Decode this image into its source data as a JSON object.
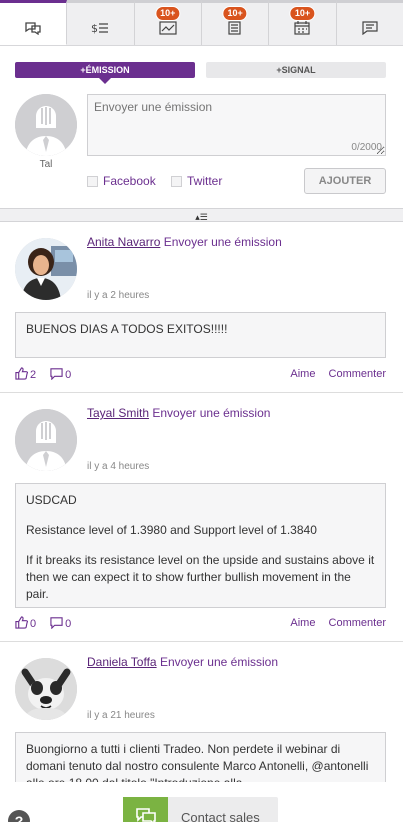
{
  "tabs": [
    {
      "icon": "messages-icon",
      "active": true,
      "badge": ""
    },
    {
      "icon": "price-list-icon",
      "active": false,
      "badge": ""
    },
    {
      "icon": "chart-icon",
      "active": false,
      "badge": "10+"
    },
    {
      "icon": "news-icon",
      "active": false,
      "badge": "10+"
    },
    {
      "icon": "calendar-icon",
      "active": false,
      "badge": "10+"
    },
    {
      "icon": "chat-icon",
      "active": false,
      "badge": ""
    }
  ],
  "compose": {
    "emission_tab": "+ÉMISSION",
    "signal_tab": "+SIGNAL",
    "user_name": "Tal",
    "placeholder": "Envoyer une émission",
    "counter": "0/2000",
    "facebook": "Facebook",
    "twitter": "Twitter",
    "add_button": "AJOUTER"
  },
  "collapse_icon": "collapse-icon",
  "feed": [
    {
      "author": "Anita Navarro",
      "action": "Envoyer une émission",
      "time": "il y a 2 heures",
      "text": [
        "BUENOS DIAS A TODOS EXITOS!!!!!"
      ],
      "likes": "2",
      "comments": "0",
      "like_label": "Aime",
      "comment_label": "Commenter"
    },
    {
      "author": "Tayal Smith",
      "action": "Envoyer une émission",
      "time": "il y a 4 heures",
      "text": [
        "USDCAD",
        "Resistance level of 1.3980 and Support level of 1.3840",
        "If it breaks its resistance level on the upside and sustains above it then we can expect it to show further bullish movement in the pair."
      ],
      "likes": "0",
      "comments": "0",
      "like_label": "Aime",
      "comment_label": "Commenter"
    },
    {
      "author": "Daniela Toffa",
      "action": "Envoyer une émission",
      "time": "il y a 21 heures",
      "text": [
        "Buongiorno a tutti i clienti Tradeo. Non perdete il webinar di domani tenuto dal nostro consulente Marco Antonelli, @antonelli alle ore 18.00 dal titolo \"Introduzione alla"
      ]
    }
  ],
  "bottom": {
    "help": "?",
    "contact_label": "Contact sales"
  },
  "colors": {
    "brand": "#6b2f8f",
    "badge": "#d9541e",
    "contact_green": "#7bb342"
  }
}
